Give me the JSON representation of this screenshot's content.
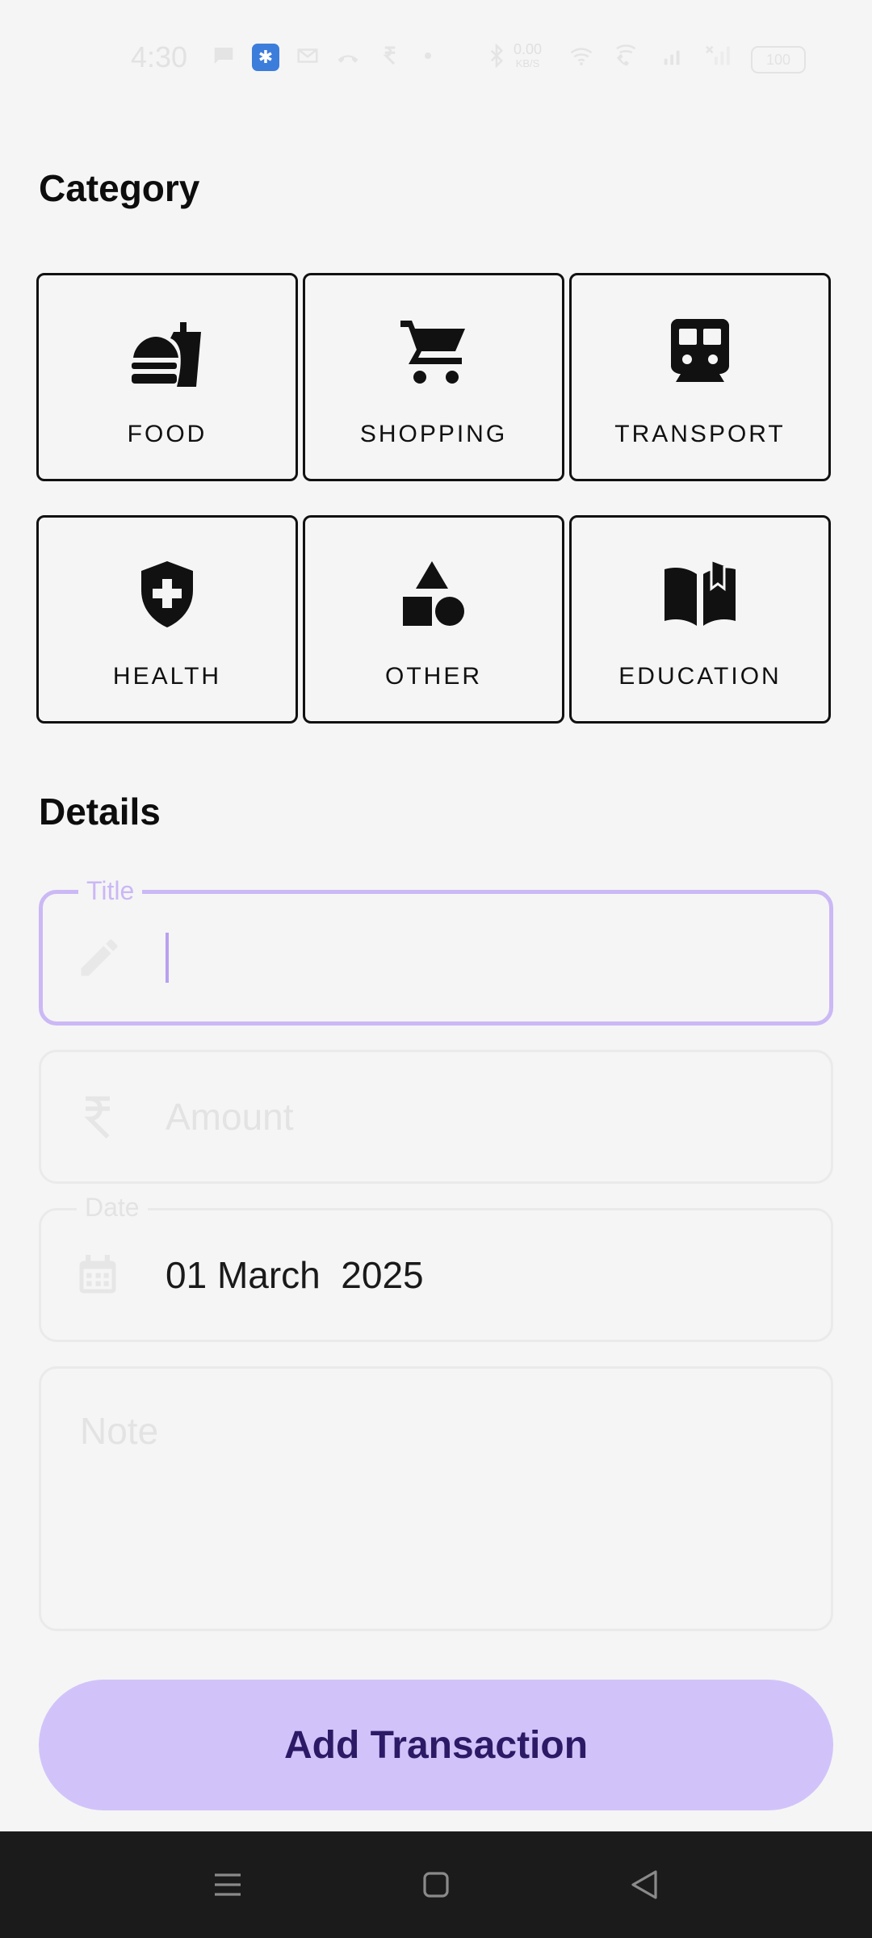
{
  "status_bar": {
    "time": "4:30",
    "speed_value": "0.00",
    "speed_unit": "KB/S",
    "battery": "100"
  },
  "category_section": {
    "heading": "Category",
    "items": [
      {
        "label": "FOOD",
        "icon": "fastfood-icon"
      },
      {
        "label": "SHOPPING",
        "icon": "shopping-cart-icon"
      },
      {
        "label": "TRANSPORT",
        "icon": "train-icon"
      },
      {
        "label": "HEALTH",
        "icon": "health-shield-icon"
      },
      {
        "label": "OTHER",
        "icon": "shapes-icon"
      },
      {
        "label": "EDUCATION",
        "icon": "book-icon"
      }
    ]
  },
  "details_section": {
    "heading": "Details",
    "title_field": {
      "label": "Title",
      "value": "",
      "icon": "pencil-icon"
    },
    "amount_field": {
      "placeholder": "Amount",
      "icon": "rupee-icon"
    },
    "date_field": {
      "label": "Date",
      "value": "01 March  2025",
      "icon": "calendar-icon"
    },
    "note_field": {
      "placeholder": "Note"
    }
  },
  "submit_button": {
    "label": "Add Transaction"
  },
  "colors": {
    "accent_light": "#d1c3fa",
    "accent_border": "#cbb8f5",
    "button_text": "#2c1a66",
    "background": "#f5f5f5",
    "nav_bar": "#1b1b1b"
  }
}
